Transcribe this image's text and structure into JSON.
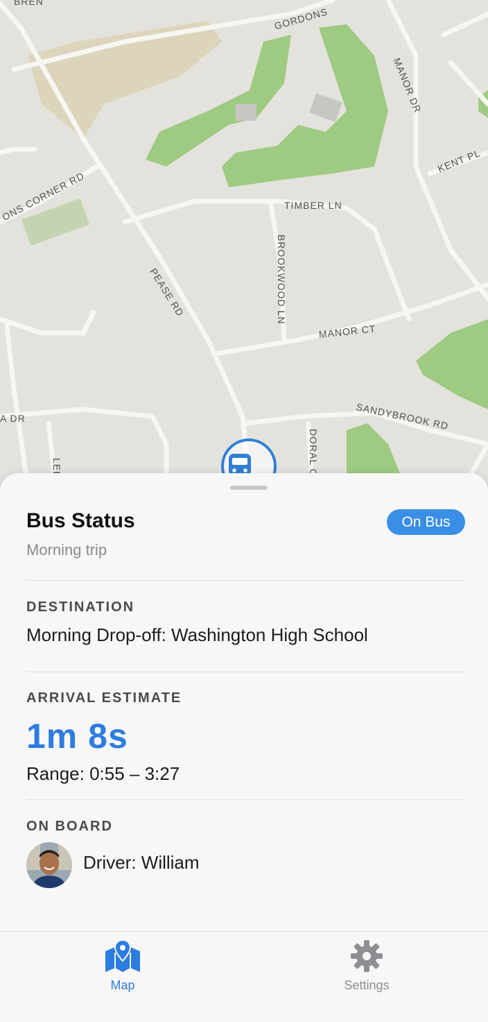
{
  "map": {
    "streets": [
      "BREN",
      "GORDONS",
      "MANOR DR",
      "KENT PL",
      "ONS CORNER RD",
      "TIMBER LN",
      "BROOKWOOD LN",
      "PEASE RD",
      "MANOR CT",
      "SANDYBROOK RD",
      "A DR",
      "DORAL C",
      "LEE"
    ]
  },
  "sheet": {
    "title": "Bus Status",
    "subtitle": "Morning trip",
    "badge": "On Bus",
    "destination_label": "DESTINATION",
    "destination_value": "Morning Drop-off: Washington High School",
    "arrival_label": "ARRIVAL ESTIMATE",
    "arrival_value": "1m 8s",
    "arrival_range": "Range: 0:55 – 3:27",
    "onboard_label": "ON BOARD",
    "driver": "Driver: William"
  },
  "tabs": [
    {
      "label": "Map",
      "icon": "map-icon",
      "active": true
    },
    {
      "label": "Settings",
      "icon": "gear-icon",
      "active": false
    }
  ],
  "colors": {
    "accent": "#2d7ce0",
    "badge": "#3a8ee6",
    "park": "#8cc46c",
    "inactive_tab": "#8e8e93"
  }
}
